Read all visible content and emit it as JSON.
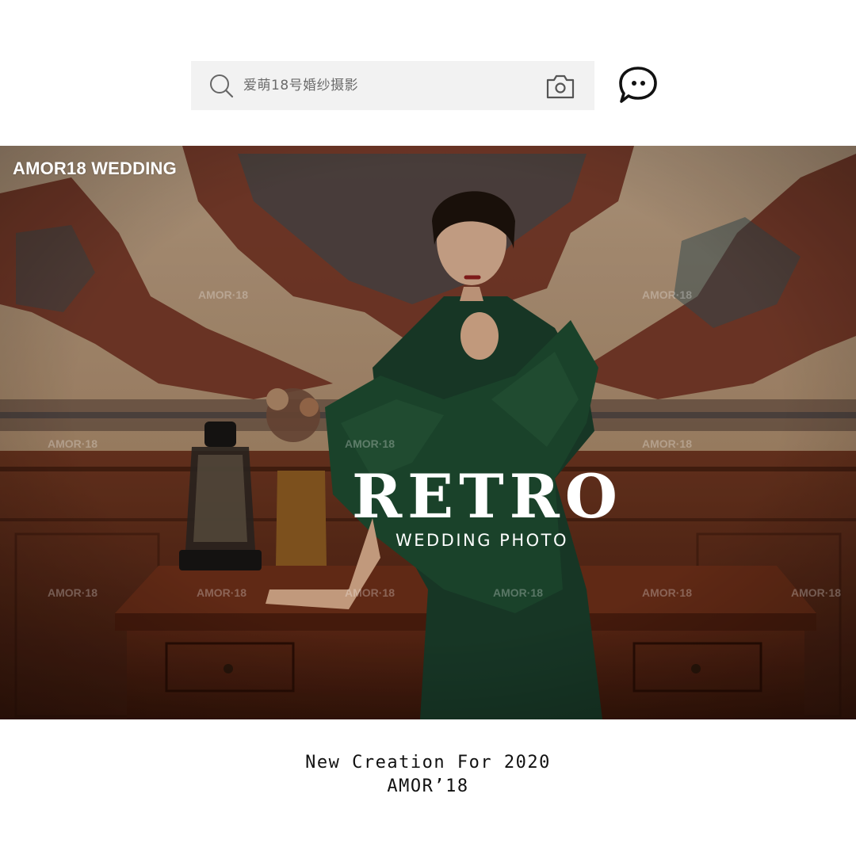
{
  "search": {
    "placeholder": "爱萌18号婚纱摄影"
  },
  "icons": {
    "search": "search-icon",
    "camera": "camera-icon",
    "chat": "chat-bubble-icon"
  },
  "hero": {
    "brand": "AMOR18  WEDDING",
    "title": "RETRO",
    "subtitle": "WEDDING PHOTO",
    "watermark": "AMOR·18"
  },
  "caption": {
    "line1": "New Creation For 2020",
    "line2": "AMOR’18"
  },
  "colors": {
    "search_bg": "#f2f2f2",
    "icon_dark": "#1a1a1a",
    "text_dark": "#111111",
    "wood": "#5a2a18",
    "dress_green": "#1f4a35"
  }
}
